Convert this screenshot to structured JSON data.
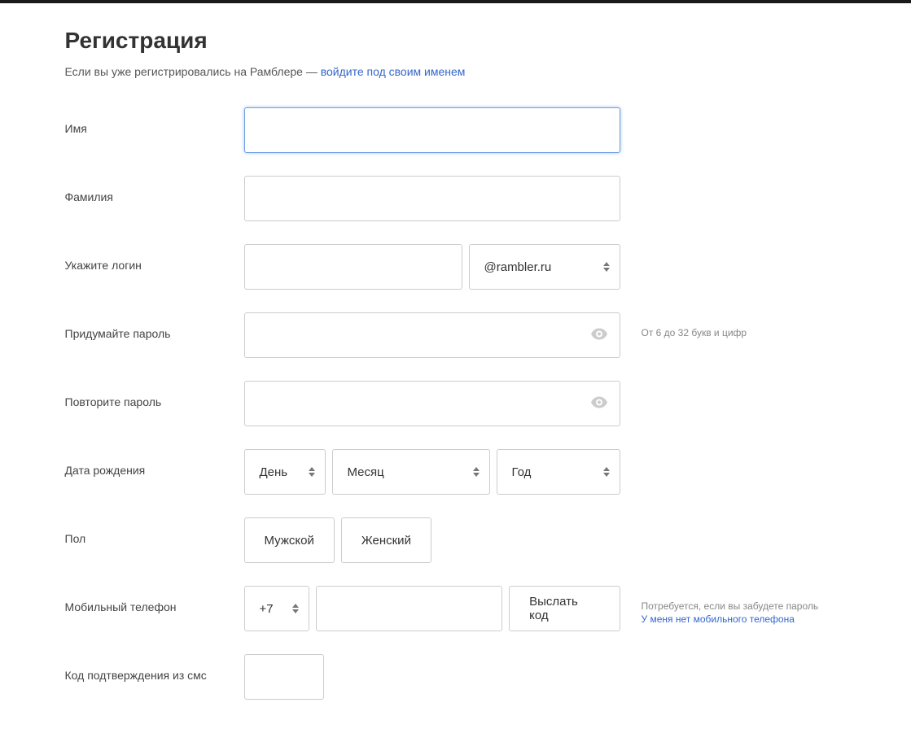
{
  "page": {
    "title": "Регистрация",
    "subhead_prefix": "Если вы уже регистрировались на Рамблере — ",
    "subhead_link": "войдите под своим именем"
  },
  "labels": {
    "firstname": "Имя",
    "lastname": "Фамилия",
    "login": "Укажите логин",
    "password": "Придумайте пароль",
    "password2": "Повторите пароль",
    "dob": "Дата рождения",
    "gender": "Пол",
    "phone": "Мобильный телефон",
    "smscode": "Код подтверждения из смс"
  },
  "fields": {
    "firstname": "",
    "lastname": "",
    "login_local": "",
    "login_domain": "@rambler.ru",
    "password": "",
    "password2": "",
    "dob_day": "День",
    "dob_month": "Месяц",
    "dob_year": "Год",
    "gender_male": "Мужской",
    "gender_female": "Женский",
    "phone_cc": "+7",
    "phone_number": "",
    "send_code_btn": "Выслать код",
    "sms_code": ""
  },
  "hints": {
    "password": "От 6 до 32 букв и цифр",
    "phone_line1": "Потребуется, если вы забудете пароль",
    "phone_link": "У меня нет мобильного телефона"
  }
}
